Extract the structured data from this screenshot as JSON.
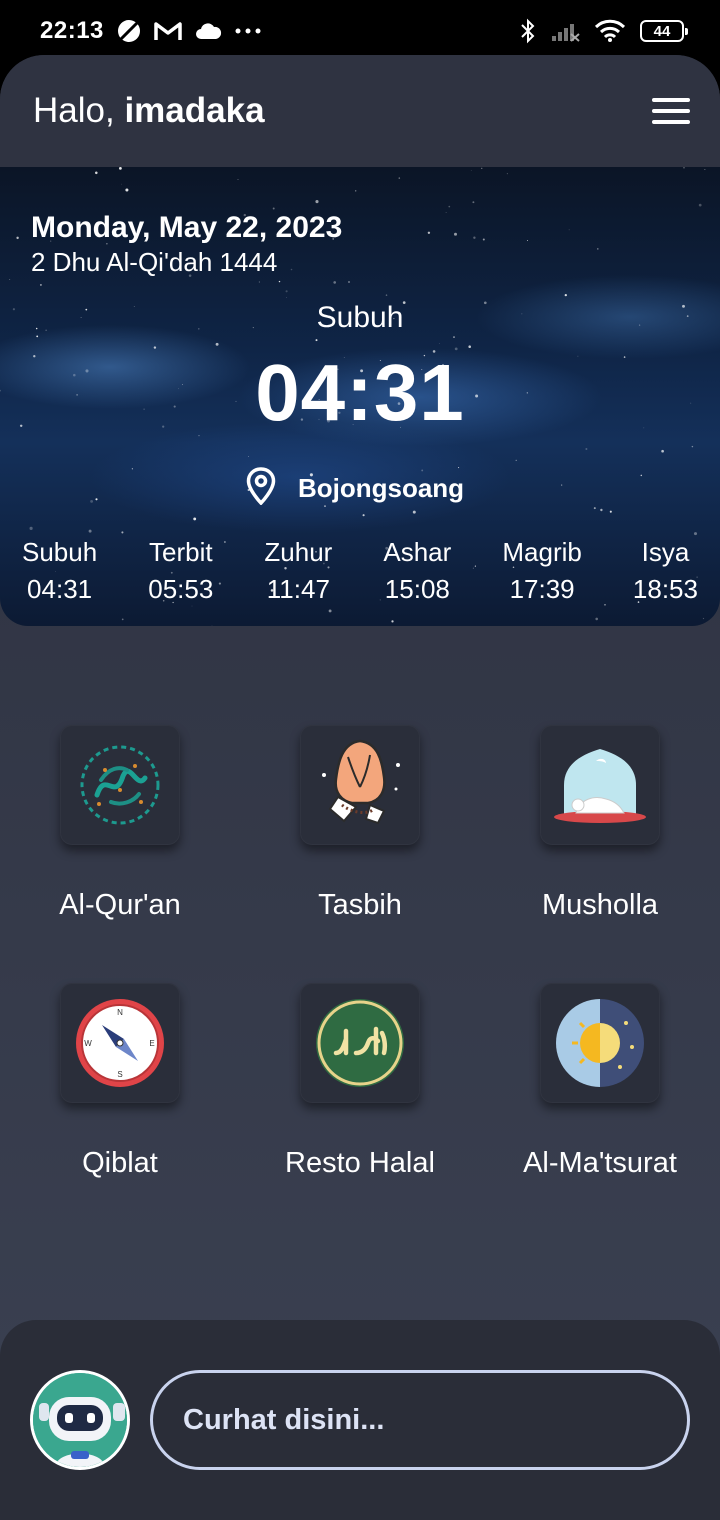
{
  "status_bar": {
    "time": "22:13",
    "battery": "44",
    "left_icons": [
      "no-disturb-icon",
      "gmail-icon",
      "cloud-icon",
      "more-dots-icon"
    ],
    "right_icons": [
      "bluetooth-icon",
      "signal-icon",
      "wifi-icon",
      "battery-icon"
    ]
  },
  "header": {
    "greeting_prefix": "Halo,",
    "username": "imadaka",
    "menu_icon": "hamburger-menu-icon"
  },
  "hero": {
    "gregorian_date": "Monday, May 22, 2023",
    "hijri_date": "2 Dhu Al-Qi'dah 1444",
    "current_prayer": "Subuh",
    "current_time": "04:31",
    "location": "Bojongsoang",
    "prayers": [
      {
        "name": "Subuh",
        "time": "04:31"
      },
      {
        "name": "Terbit",
        "time": "05:53"
      },
      {
        "name": "Zuhur",
        "time": "11:47"
      },
      {
        "name": "Ashar",
        "time": "15:08"
      },
      {
        "name": "Magrib",
        "time": "17:39"
      },
      {
        "name": "Isya",
        "time": "18:53"
      }
    ]
  },
  "menu": [
    {
      "label": "Al-Qur'an",
      "icon": "quran-calligraphy-icon"
    },
    {
      "label": "Tasbih",
      "icon": "praying-hands-icon"
    },
    {
      "label": "Musholla",
      "icon": "mosque-prayer-icon"
    },
    {
      "label": "Qiblat",
      "icon": "compass-icon"
    },
    {
      "label": "Resto Halal",
      "icon": "halal-badge-icon"
    },
    {
      "label": "Al-Ma'tsurat",
      "icon": "day-night-icon"
    }
  ],
  "chat": {
    "placeholder": "Curhat disini...",
    "avatar_icon": "robot-avatar-icon"
  },
  "colors": {
    "app_bg": "#2b2f3d",
    "tile_bg": "#2a2e3a",
    "chat_border": "#c9d3ee"
  }
}
